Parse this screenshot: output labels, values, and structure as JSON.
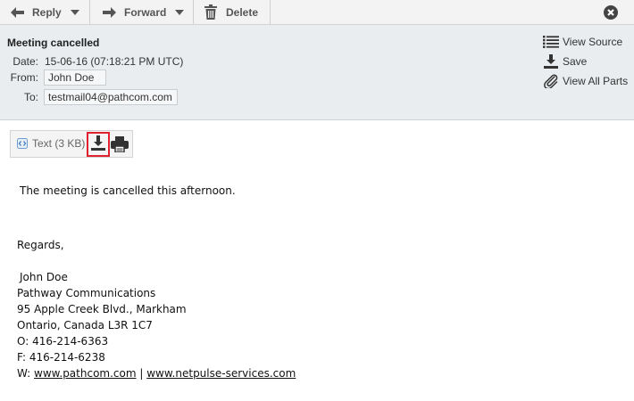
{
  "toolbar": {
    "reply_label": "Reply",
    "forward_label": "Forward",
    "delete_label": "Delete"
  },
  "message": {
    "subject": "Meeting cancelled",
    "date_label": "Date:",
    "date_value": "15-06-16 (07:18:21 PM UTC)",
    "from_label": "From:",
    "from_value": "John Doe",
    "to_label": "To:",
    "to_value": "testmail04@pathcom.com"
  },
  "actions": {
    "view_source": "View Source",
    "save": "Save",
    "view_all_parts": "View All Parts"
  },
  "attachment": {
    "label": "Text (3 KB)"
  },
  "body": {
    "line1": "The meeting is cancelled this afternoon.",
    "regards": "Regards,",
    "sig_name": "John Doe",
    "sig_company": "Pathway Communications",
    "sig_address1": "95 Apple Creek Blvd., Markham",
    "sig_address2": "Ontario, Canada L3R 1C7",
    "sig_phone": "O: 416-214-6363",
    "sig_fax": "F: 416-214-6238",
    "sig_web_prefix": "W: ",
    "sig_link1": "www.pathcom.com",
    "sig_separator": " | ",
    "sig_link2": "www.netpulse-services.com"
  },
  "colors": {
    "toolbar_bg": "#f3f3f3",
    "header_bg": "#e9edf0",
    "highlight": "#e0212f"
  },
  "icons": [
    "arrow-left-icon",
    "arrow-right-icon",
    "trash-icon",
    "close-circle-icon",
    "list-icon",
    "download-icon",
    "paperclip-icon",
    "text-file-icon",
    "printer-icon"
  ]
}
